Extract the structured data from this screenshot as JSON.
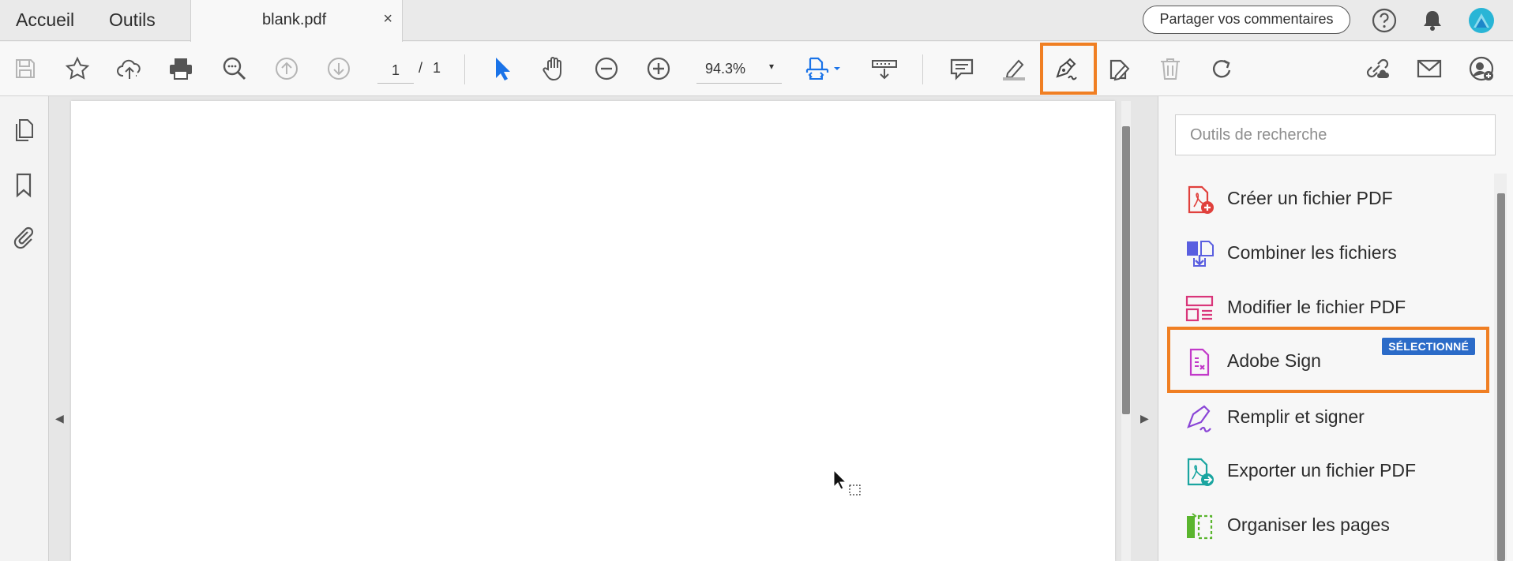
{
  "tabbar": {
    "home_label": "Accueil",
    "tools_label": "Outils",
    "document_tab": {
      "name": "blank.pdf",
      "close_glyph": "×"
    },
    "share_button": "Partager vos commentaires",
    "icons": [
      "help-icon",
      "notification-bell-icon",
      "account-avatar-icon"
    ]
  },
  "toolbar": {
    "icons": [
      "save-icon",
      "bookmark-star-icon",
      "upload-cloud-icon",
      "print-icon",
      "search-zoom-icon",
      "previous-page-icon",
      "next-page-icon",
      "select-cursor-icon",
      "hand-tool-icon",
      "zoom-out-icon",
      "zoom-in-icon",
      "fit-page-icon",
      "scroll-mode-icon",
      "comment-icon",
      "highlight-icon",
      "sign-pen-icon",
      "edit-document-icon",
      "delete-icon",
      "rotate-icon",
      "share-link-icon",
      "email-icon",
      "add-user-icon"
    ],
    "page_current": "1",
    "page_separator": "/",
    "page_total": "1",
    "zoom_value": "94.3%",
    "zoom_arrow": "▾",
    "highlighted_tool": "sign-pen-icon"
  },
  "left_rail": {
    "icons": [
      "page-thumbnails-icon",
      "bookmarks-icon",
      "attachments-icon"
    ],
    "collapse_glyph": "◀"
  },
  "right_collapse_glyph": "▶",
  "tools_pane": {
    "search_placeholder": "Outils de recherche",
    "items": [
      {
        "label": "Créer un fichier PDF",
        "icon": "create-pdf-icon"
      },
      {
        "label": "Combiner les fichiers",
        "icon": "combine-files-icon"
      },
      {
        "label": "Modifier le fichier PDF",
        "icon": "edit-pdf-icon"
      },
      {
        "label": "Adobe Sign",
        "icon": "adobe-sign-icon",
        "badge": "SÉLECTIONNÉ"
      },
      {
        "label": "Remplir et signer",
        "icon": "fill-sign-icon"
      },
      {
        "label": "Exporter un fichier PDF",
        "icon": "export-pdf-icon"
      },
      {
        "label": "Organiser les pages",
        "icon": "organize-pages-icon"
      }
    ]
  },
  "colors": {
    "accent_highlight": "#f07f23",
    "selected_badge": "#2b6bc8",
    "toolbar_blue": "#1a73e8",
    "create_pdf": "#e0403c",
    "combine": "#5a5fe0",
    "edit_pdf": "#d9367a",
    "adobe_sign": "#c23ac9",
    "fill_sign": "#8a45d6",
    "export_pdf": "#1aa5a0",
    "organize": "#5ab52e"
  }
}
